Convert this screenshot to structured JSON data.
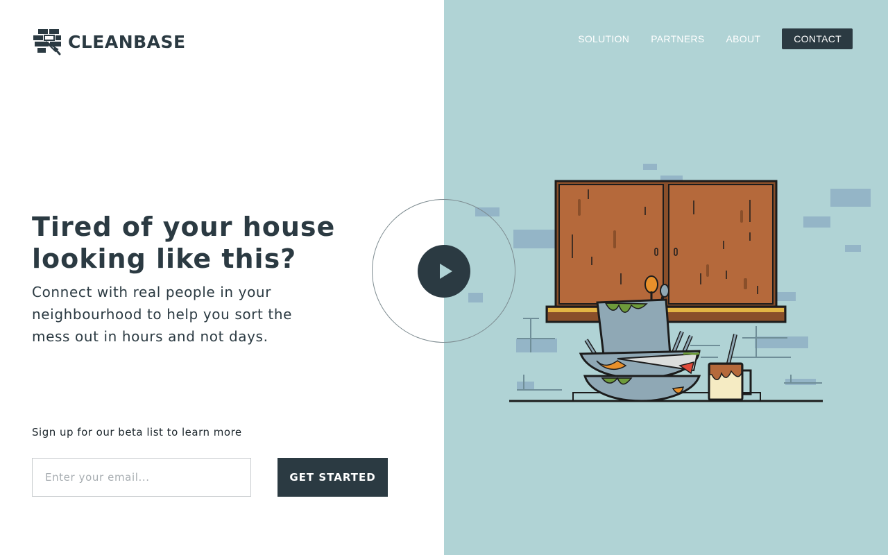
{
  "brand": {
    "name": "CLEANBASE",
    "logo_icon": "brick-and-brush-icon"
  },
  "nav": {
    "items": [
      {
        "label": "SOLUTION"
      },
      {
        "label": "PARTNERS"
      },
      {
        "label": "ABOUT"
      },
      {
        "label": "CONTACT"
      }
    ]
  },
  "hero": {
    "title": "Tired of your house looking like this?",
    "subtitle": "Connect with real people in your neighbourhood to help you sort the mess out in hours and not days."
  },
  "signup": {
    "label": "Sign up for our beta list to learn more",
    "email_placeholder": "Enter your email...",
    "email_value": "",
    "button_label": "GET STARTED"
  },
  "video": {
    "play_icon": "play-icon"
  },
  "illustration": {
    "subject": "dirty-dishes-under-cabinet"
  },
  "colors": {
    "ink": "#2b3a42",
    "panel": "#b0d3d5",
    "brick": "#94b5c7",
    "cabinet": "#b5693b",
    "dish": "#8fa8b5",
    "slime": "#6e9b3b",
    "sauce": "#e8902b",
    "mug": "#f5ebc3"
  }
}
